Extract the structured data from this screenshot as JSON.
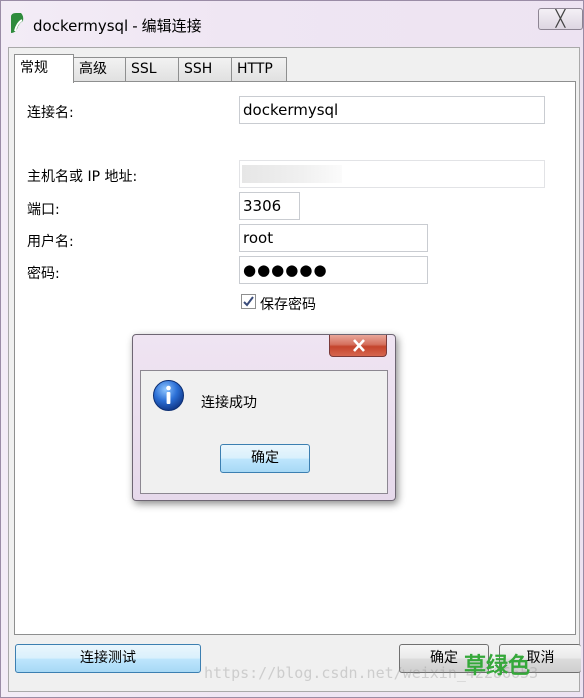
{
  "window": {
    "title": "dockermysql",
    "title_sep": "-",
    "title_suffix": "编辑连接",
    "close_glyph": "╳"
  },
  "tabs": [
    {
      "label": "常规",
      "active": true
    },
    {
      "label": "高级",
      "active": false
    },
    {
      "label": "SSL",
      "active": false
    },
    {
      "label": "SSH",
      "active": false
    },
    {
      "label": "HTTP",
      "active": false
    }
  ],
  "form": {
    "connection_name_label": "连接名:",
    "connection_name_value": "dockermysql",
    "host_label": "主机名或 IP 地址:",
    "port_label": "端口:",
    "port_value": "3306",
    "username_label": "用户名:",
    "username_value": "root",
    "password_label": "密码:",
    "password_value": "●●●●●●",
    "save_password_label": "保存密码",
    "save_password_checked": true
  },
  "footer": {
    "test_button": "连接测试",
    "ok_button": "确定",
    "cancel_button": "取消"
  },
  "dialog": {
    "message": "连接成功",
    "ok_button": "确定",
    "icon": "info-icon"
  },
  "overlay": {
    "watermark": "https://blog.csdn.net/weixin_42286653",
    "stamp": "草绿色"
  }
}
